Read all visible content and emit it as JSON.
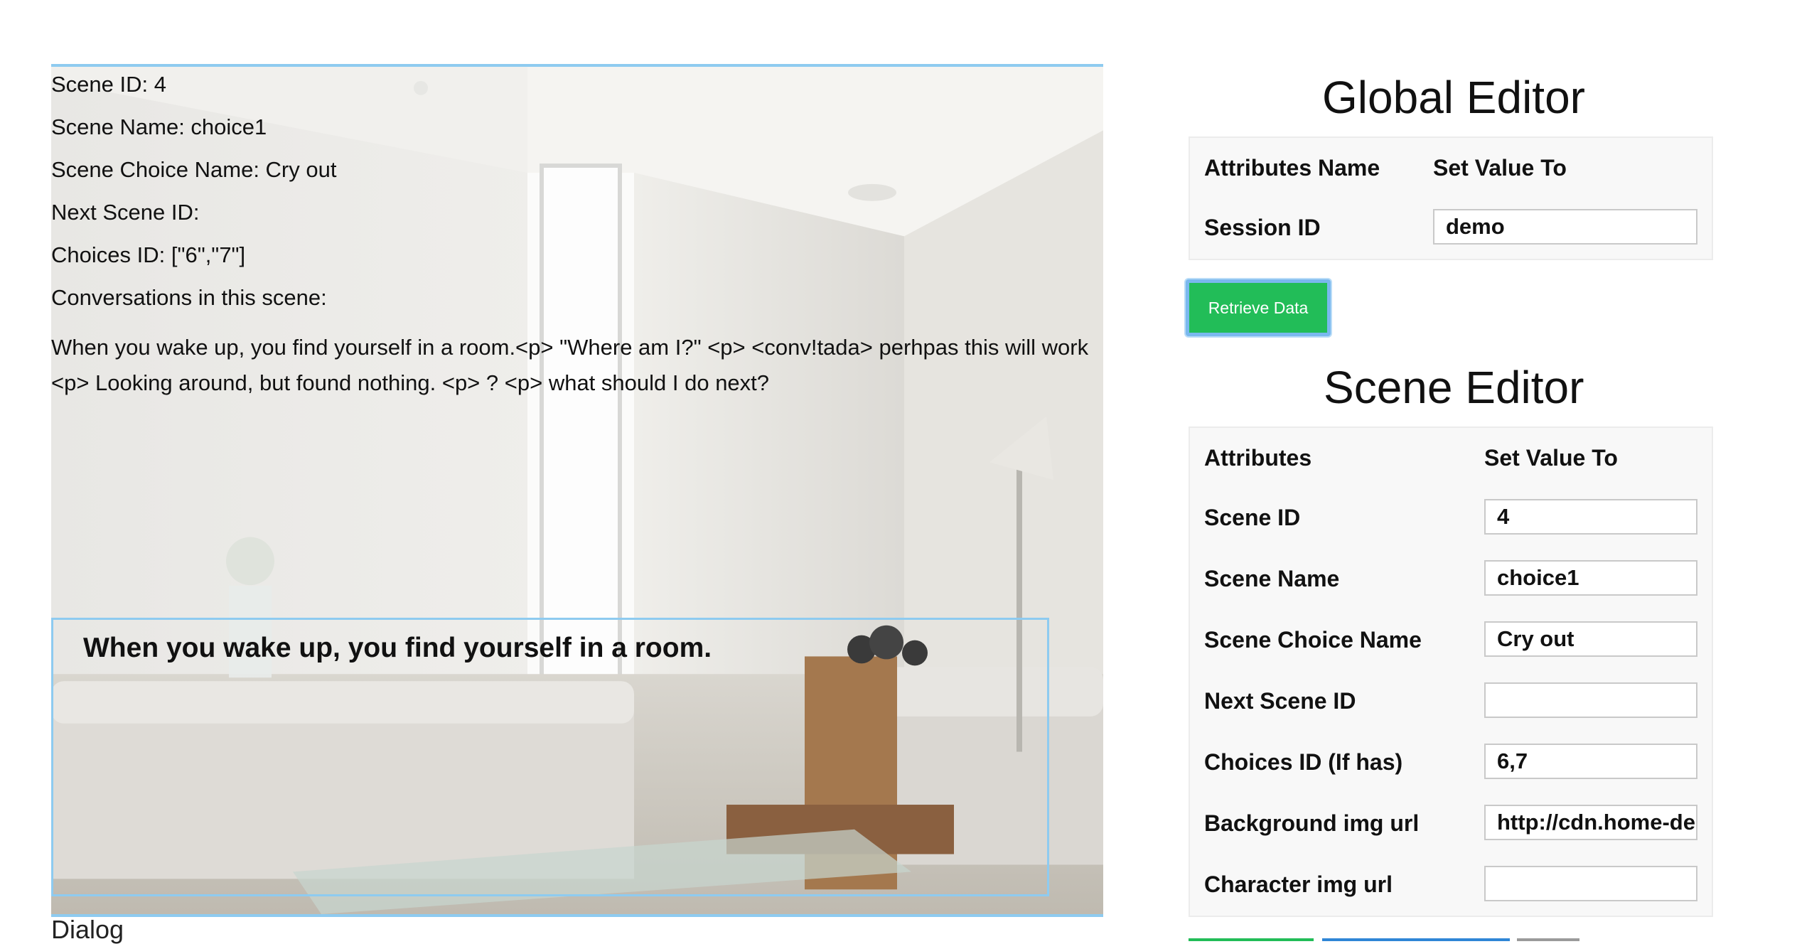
{
  "scene_info": {
    "scene_id": "Scene ID: 4",
    "scene_name": "Scene Name: choice1",
    "scene_choice_name": "Scene Choice Name: Cry out",
    "next_scene_id": "Next Scene ID:",
    "choices_id": "Choices ID: [\"6\",\"7\"]",
    "conversations_label": "Conversations in this scene:",
    "conversations_text": "When you wake up, you find yourself in a room.<p> \"Where am I?\" <p> <conv!tada> perhpas this will work <p> Looking around, but found nothing. <p> ? <p> what should I do next?"
  },
  "dialog": {
    "text": "When you wake up, you find yourself in a room.",
    "label": "Dialog"
  },
  "global_editor": {
    "title": "Global Editor",
    "col_attr": "Attributes Name",
    "col_value": "Set Value To",
    "session_label": "Session ID",
    "session_value": "demo",
    "retrieve_button": "Retrieve Data"
  },
  "scene_editor": {
    "title": "Scene Editor",
    "col_attr": "Attributes",
    "col_value": "Set Value To",
    "rows": [
      {
        "label": "Scene ID",
        "value": "4"
      },
      {
        "label": "Scene Name",
        "value": "choice1"
      },
      {
        "label": "Scene Choice Name",
        "value": "Cry out"
      },
      {
        "label": "Next Scene ID",
        "value": ""
      },
      {
        "label": "Choices ID (If has)",
        "value": "6,7"
      },
      {
        "label": "Background img url",
        "value": "http://cdn.home-designing.com/"
      },
      {
        "label": "Character img url",
        "value": ""
      }
    ]
  },
  "colors": {
    "accent_border": "#8ecbf0",
    "retrieve_green": "#22bd58",
    "bottom_blue": "#2f86d6"
  }
}
